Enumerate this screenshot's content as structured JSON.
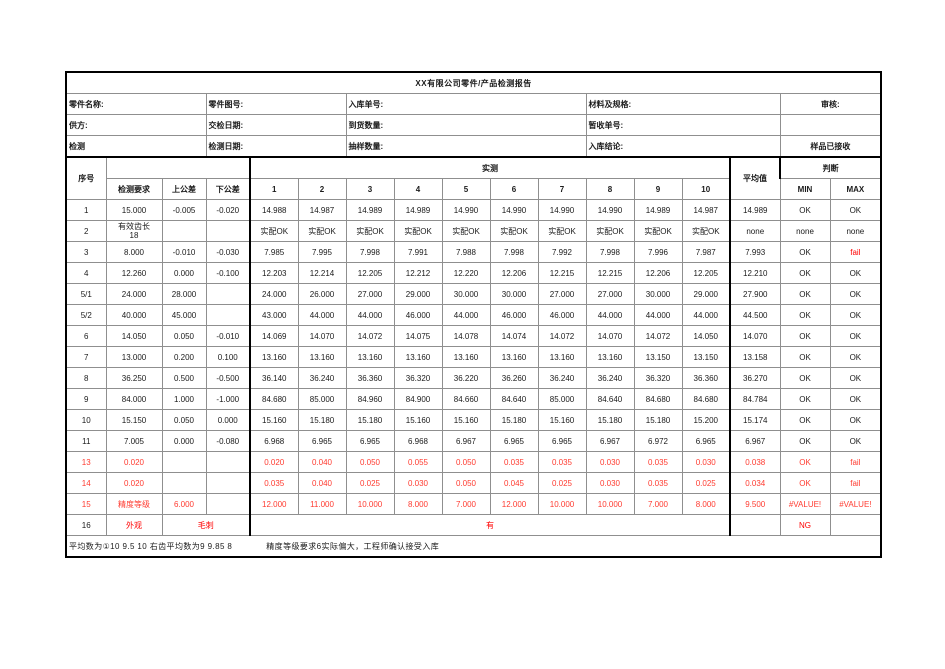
{
  "report": {
    "title": "XX有限公司零件/产品检测报告",
    "info_rows": [
      [
        {
          "label": "零件名称:",
          "value": ""
        },
        {
          "label": "零件图号:",
          "value": ""
        },
        {
          "label": "入库单号:",
          "value": ""
        },
        {
          "label": "材料及规格:",
          "value": ""
        },
        {
          "label": "审核:",
          "value": ""
        }
      ],
      [
        {
          "label": "供方:",
          "value": ""
        },
        {
          "label": "交检日期:",
          "value": ""
        },
        {
          "label": "到货数量:",
          "value": ""
        },
        {
          "label": "暂收单号:",
          "value": ""
        },
        {
          "label": "",
          "value": ""
        }
      ],
      [
        {
          "label": "检测",
          "value": ""
        },
        {
          "label": "检测日期:",
          "value": ""
        },
        {
          "label": "抽样数量:",
          "value": ""
        },
        {
          "label": "入库结论:",
          "value": ""
        },
        {
          "label": "样品已接收",
          "value": ""
        }
      ]
    ],
    "columns": {
      "index": "序号",
      "requirement": "检测要求",
      "upper_tol": "上公差",
      "lower_tol": "下公差",
      "measured_group": "实测",
      "measure_nums": [
        "1",
        "2",
        "3",
        "4",
        "5",
        "6",
        "7",
        "8",
        "9",
        "10"
      ],
      "average": "平均值",
      "judge_group": "判断",
      "judge_min": "MIN",
      "judge_max": "MAX"
    },
    "rows": [
      {
        "index": "1",
        "requirement": "15.000",
        "upper": "-0.005",
        "lower": "-0.020",
        "values": [
          "14.988",
          "14.987",
          "14.989",
          "14.989",
          "14.990",
          "14.990",
          "14.990",
          "14.990",
          "14.989",
          "14.987"
        ],
        "average": "14.989",
        "min": "OK",
        "max": "OK",
        "red": false
      },
      {
        "index": "2",
        "requirement": "有效齿长 18",
        "upper": "",
        "lower": "",
        "values": [
          "实配OK",
          "实配OK",
          "实配OK",
          "实配OK",
          "实配OK",
          "实配OK",
          "实配OK",
          "实配OK",
          "实配OK",
          "实配OK"
        ],
        "average": "none",
        "min": "none",
        "max": "none",
        "red": false
      },
      {
        "index": "3",
        "requirement": "8.000",
        "upper": "-0.010",
        "lower": "-0.030",
        "values": [
          "7.985",
          "7.995",
          "7.998",
          "7.991",
          "7.988",
          "7.998",
          "7.992",
          "7.998",
          "7.996",
          "7.987"
        ],
        "average": "7.993",
        "min": "OK",
        "max": "fail",
        "red": false,
        "max_red": true
      },
      {
        "index": "4",
        "requirement": "12.260",
        "upper": "0.000",
        "lower": "-0.100",
        "values": [
          "12.203",
          "12.214",
          "12.205",
          "12.212",
          "12.220",
          "12.206",
          "12.215",
          "12.215",
          "12.206",
          "12.205"
        ],
        "average": "12.210",
        "min": "OK",
        "max": "OK",
        "red": false
      },
      {
        "index": "5/1",
        "requirement": "24.000",
        "upper": "28.000",
        "lower": "",
        "values": [
          "24.000",
          "26.000",
          "27.000",
          "29.000",
          "30.000",
          "30.000",
          "27.000",
          "27.000",
          "30.000",
          "29.000"
        ],
        "average": "27.900",
        "min": "OK",
        "max": "OK",
        "red": false
      },
      {
        "index": "5/2",
        "requirement": "40.000",
        "upper": "45.000",
        "lower": "",
        "values": [
          "43.000",
          "44.000",
          "44.000",
          "46.000",
          "44.000",
          "46.000",
          "46.000",
          "44.000",
          "44.000",
          "44.000"
        ],
        "average": "44.500",
        "min": "OK",
        "max": "OK",
        "red": false
      },
      {
        "index": "6",
        "requirement": "14.050",
        "upper": "0.050",
        "lower": "-0.010",
        "values": [
          "14.069",
          "14.070",
          "14.072",
          "14.075",
          "14.078",
          "14.074",
          "14.072",
          "14.070",
          "14.072",
          "14.050"
        ],
        "average": "14.070",
        "min": "OK",
        "max": "OK",
        "red": false
      },
      {
        "index": "7",
        "requirement": "13.000",
        "upper": "0.200",
        "lower": "0.100",
        "values": [
          "13.160",
          "13.160",
          "13.160",
          "13.160",
          "13.160",
          "13.160",
          "13.160",
          "13.160",
          "13.150",
          "13.150"
        ],
        "average": "13.158",
        "min": "OK",
        "max": "OK",
        "red": false
      },
      {
        "index": "8",
        "requirement": "36.250",
        "upper": "0.500",
        "lower": "-0.500",
        "values": [
          "36.140",
          "36.240",
          "36.360",
          "36.320",
          "36.220",
          "36.260",
          "36.240",
          "36.240",
          "36.320",
          "36.360"
        ],
        "average": "36.270",
        "min": "OK",
        "max": "OK",
        "red": false
      },
      {
        "index": "9",
        "requirement": "84.000",
        "upper": "1.000",
        "lower": "-1.000",
        "values": [
          "84.680",
          "85.000",
          "84.960",
          "84.900",
          "84.660",
          "84.640",
          "85.000",
          "84.640",
          "84.680",
          "84.680"
        ],
        "average": "84.784",
        "min": "OK",
        "max": "OK",
        "red": false
      },
      {
        "index": "10",
        "requirement": "15.150",
        "upper": "0.050",
        "lower": "0.000",
        "values": [
          "15.160",
          "15.180",
          "15.180",
          "15.160",
          "15.160",
          "15.180",
          "15.160",
          "15.180",
          "15.180",
          "15.200"
        ],
        "average": "15.174",
        "min": "OK",
        "max": "OK",
        "red": false
      },
      {
        "index": "11",
        "requirement": "7.005",
        "upper": "0.000",
        "lower": "-0.080",
        "values": [
          "6.968",
          "6.965",
          "6.965",
          "6.968",
          "6.967",
          "6.965",
          "6.965",
          "6.967",
          "6.972",
          "6.965"
        ],
        "average": "6.967",
        "min": "OK",
        "max": "OK",
        "red": false
      },
      {
        "index": "13",
        "requirement": "0.020",
        "upper": "",
        "lower": "",
        "values": [
          "0.020",
          "0.040",
          "0.050",
          "0.055",
          "0.050",
          "0.035",
          "0.035",
          "0.030",
          "0.035",
          "0.030"
        ],
        "average": "0.038",
        "min": "OK",
        "max": "fail",
        "red": true
      },
      {
        "index": "14",
        "requirement": "0.020",
        "upper": "",
        "lower": "",
        "values": [
          "0.035",
          "0.040",
          "0.025",
          "0.030",
          "0.050",
          "0.045",
          "0.025",
          "0.030",
          "0.035",
          "0.025"
        ],
        "average": "0.034",
        "min": "OK",
        "max": "fail",
        "red": true
      },
      {
        "index": "15",
        "requirement": "精度等级",
        "upper": "6.000",
        "lower": "",
        "values": [
          "12.000",
          "11.000",
          "10.000",
          "8.000",
          "7.000",
          "12.000",
          "10.000",
          "10.000",
          "7.000",
          "8.000"
        ],
        "average": "9.500",
        "min": "#VALUE!",
        "max": "#VALUE!",
        "red": true
      }
    ],
    "appearance_row": {
      "index": "16",
      "requirement": "外观",
      "defect": "毛刺",
      "result": "有",
      "average": "",
      "min": "NG",
      "max": ""
    },
    "note": "平均数为①10  9.5  10  右齿平均数为9  9.85  8",
    "note_tail": "精度等级要求6实际偏大，工程师确认接受入库"
  }
}
